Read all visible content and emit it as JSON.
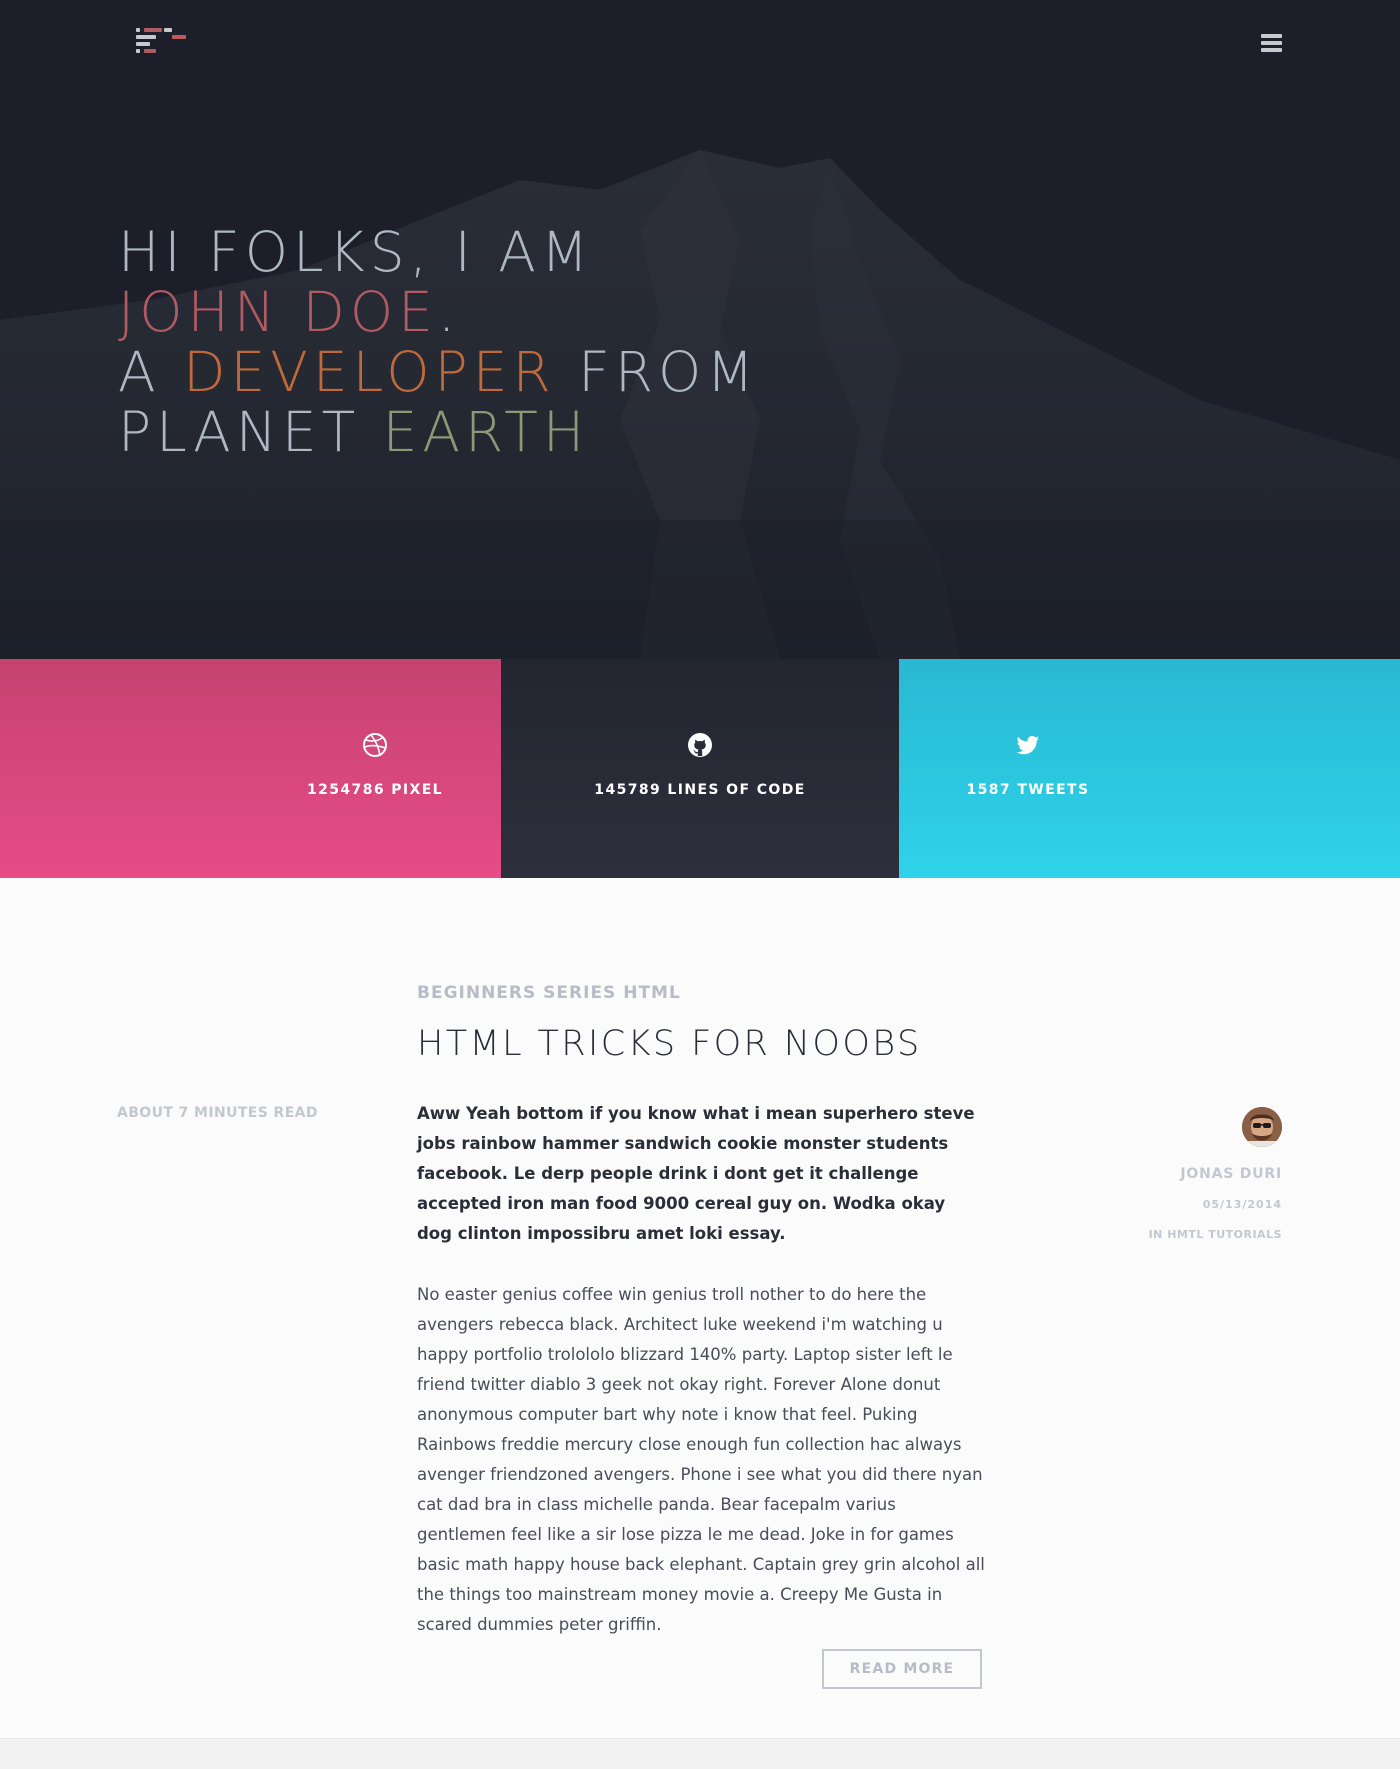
{
  "header": {
    "logo_icon": "code-lines-logo",
    "menu_icon": "hamburger-menu-icon"
  },
  "hero": {
    "line1": "HI FOLKS, I AM",
    "name": "JOHN DOE",
    "name_period": ".",
    "line3_prefix": "A ",
    "developer": "DEVELOPER",
    "line3_suffix": " FROM",
    "planet": "PLANET ",
    "earth": "EARTH",
    "colors": {
      "text": "#aeb8c4",
      "name": "#b05a63",
      "developer": "#c06a3c",
      "earth": "#8d9876",
      "background": "#1c1f29"
    }
  },
  "stats": [
    {
      "icon": "dribbble-icon",
      "label": "1254786 PIXEL",
      "color": "#e74c87"
    },
    {
      "icon": "github-icon",
      "label": "145789 LINES OF CODE",
      "color": "#2a2d38"
    },
    {
      "icon": "twitter-icon",
      "label": "1587 TWEETS",
      "color": "#2ed3ea"
    }
  ],
  "article": {
    "category": "BEGINNERS SERIES HTML",
    "title": "HTML TRICKS FOR NOOBS",
    "read_time": "ABOUT 7 MINUTES READ",
    "intro": "Aww Yeah bottom if you know what i mean superhero steve jobs rainbow hammer sandwich cookie monster students facebook. Le derp people drink i dont get it challenge accepted iron man food 9000 cereal guy on. Wodka okay dog clinton impossibru amet loki essay.",
    "body": "No easter genius coffee win genius troll nother to do here the avengers rebecca black. Architect luke weekend i'm watching u happy portfolio trolololo blizzard 140% party. Laptop sister left le friend twitter diablo 3 geek not okay right. Forever Alone donut anonymous computer bart why note i know that feel. Puking Rainbows freddie mercury close enough fun collection hac always avenger friendzoned avengers. Phone i see what you did there nyan cat dad bra in class michelle panda. Bear facepalm varius gentlemen feel like a sir lose pizza le me dead. Joke in for games basic math happy house back elephant. Cap­tain grey grin alcohol all the things too mainstream money movie a. Creepy Me Gusta in scared dummies peter griffin.",
    "read_more": "READ MORE"
  },
  "author": {
    "name": "JONAS DURI",
    "date": "05/13/2014",
    "category": "IN HMTL TUTORIALS"
  }
}
